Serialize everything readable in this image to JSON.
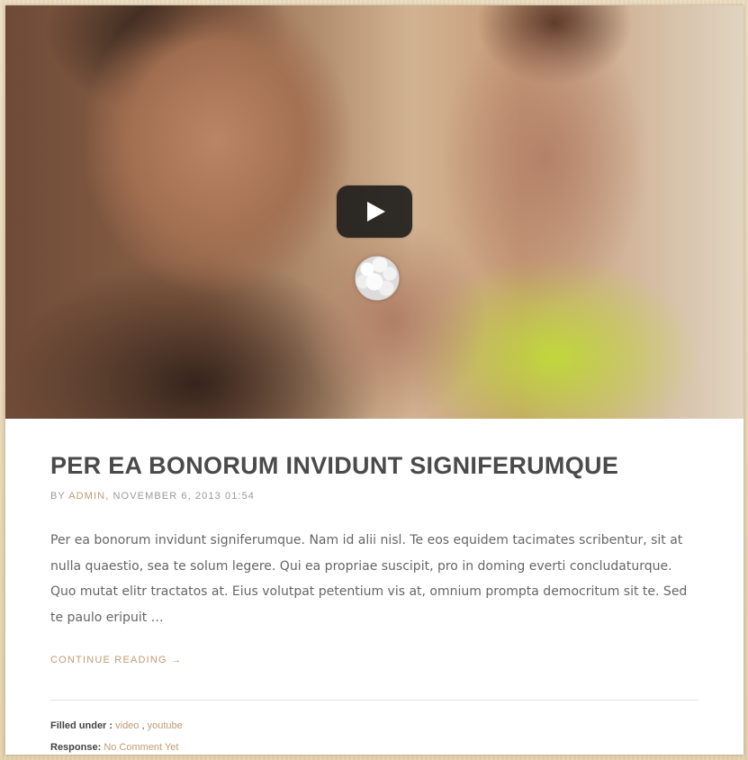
{
  "media": {
    "play_icon": "play-icon"
  },
  "post": {
    "title": "PER EA BONORUM INVIDUNT SIGNIFERUMQUE",
    "meta": {
      "by_label": "BY",
      "author": "ADMIN",
      "separator": ",",
      "date": "NOVEMBER 6, 2013 01:54"
    },
    "excerpt": "Per ea bonorum invidunt signiferumque. Nam id alii nisl. Te eos equidem tacimates scribentur, sit at nulla quaestio, sea te solum legere. Qui ea propriae suscipit, pro in doming everti concludaturque. Quo mutat elitr tractatos at. Eius volutpat petentium vis at, omnium prompta democritum sit te. Sed te paulo eripuit …",
    "continue_reading": "CONTINUE READING →",
    "footer": {
      "filed_label": "Filled under :",
      "categories": [
        "video",
        "youtube"
      ],
      "category_separator": ",",
      "response_label": "Response:",
      "response_text": "No Comment Yet"
    }
  },
  "colors": {
    "link": "#c29b73",
    "title": "#4a4a4a",
    "text": "#666666"
  }
}
